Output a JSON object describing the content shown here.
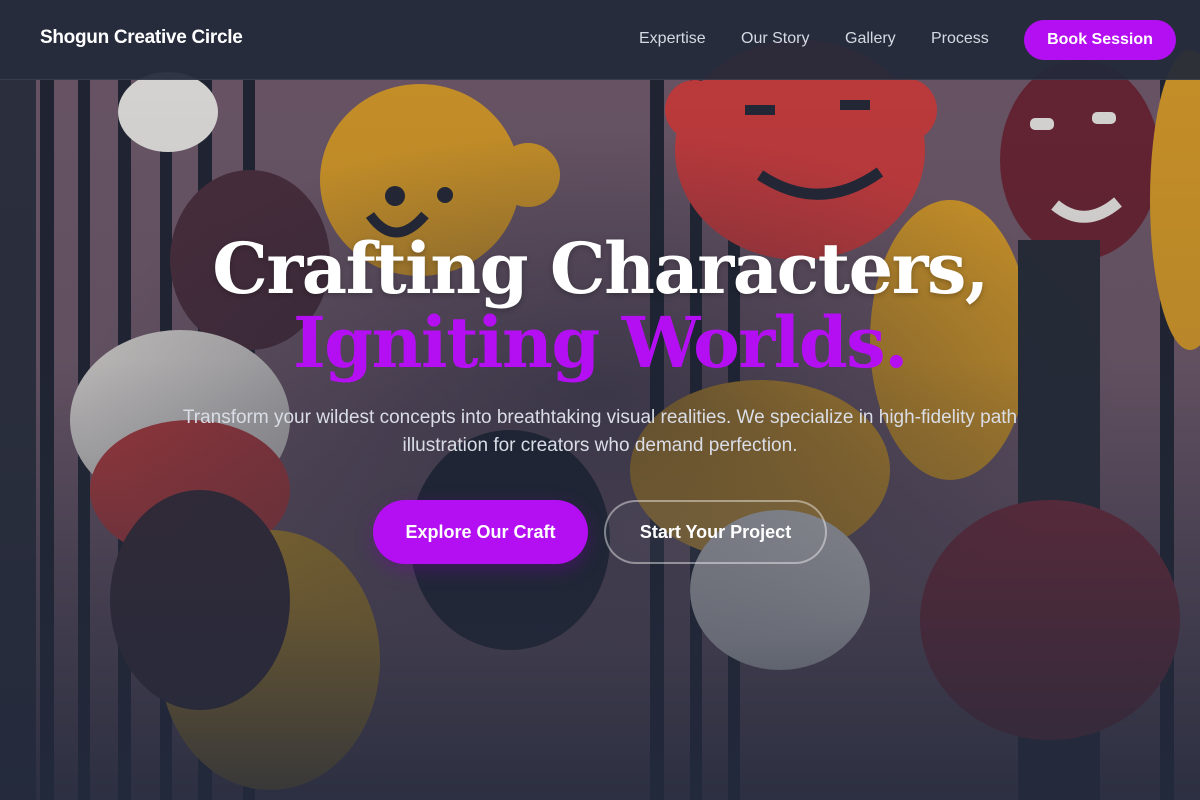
{
  "nav": {
    "brand": "Shogun Creative Circle",
    "links": [
      "Expertise",
      "Our Story",
      "Gallery",
      "Process"
    ],
    "cta": "Book Session"
  },
  "hero": {
    "title_line1": "Crafting Characters,",
    "title_line2": "Igniting Worlds.",
    "subtitle": "Transform your wildest concepts into breathtaking visual realities. We specialize in high-fidelity path illustration for creators who demand perfection.",
    "primary_cta": "Explore Our Craft",
    "secondary_cta": "Start Your Project"
  },
  "colors": {
    "accent": "#b40ff2",
    "nav_background": "#22293a",
    "text_light": "#ffffff",
    "text_muted": "#dadde6"
  },
  "background_image": "painted-characters-mural"
}
